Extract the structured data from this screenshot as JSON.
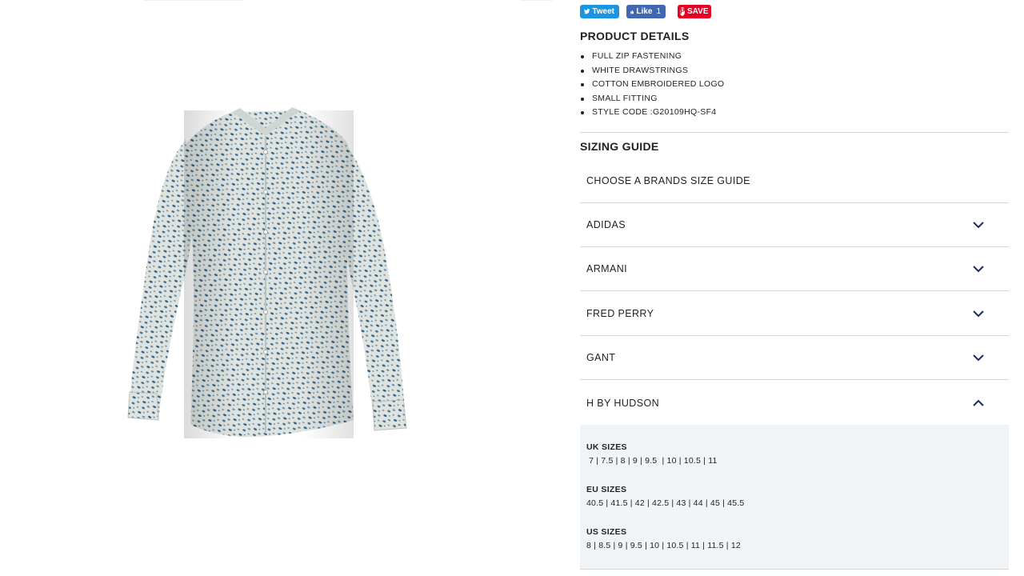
{
  "share": {
    "tweet_label": "Tweet",
    "like_label": "Like",
    "like_count": "1",
    "save_label": "SAVE"
  },
  "product_details": {
    "title": "PRODUCT DETAILS",
    "items": [
      "FULL ZIP FASTENING",
      "WHITE DRAWSTRINGS",
      "COTTON EMBROIDERED LOGO",
      "SMALL FITTING",
      "STYLE CODE :G20109HQ-SF4"
    ]
  },
  "sizing_guide": {
    "title": "SIZING GUIDE",
    "choose_label": "CHOOSE A BRANDS SIZE GUIDE",
    "brands": [
      {
        "label": "ADIDAS",
        "expanded": false
      },
      {
        "label": "ARMANI",
        "expanded": false
      },
      {
        "label": "FRED PERRY",
        "expanded": false
      },
      {
        "label": "GANT",
        "expanded": false
      },
      {
        "label": "H BY HUDSON",
        "expanded": true
      }
    ],
    "expanded_sizes": {
      "uk": {
        "label": "UK SIZES",
        "values": " 7 | 7.5 | 8 | 9 | 9.5  | 10 | 10.5 | 11"
      },
      "eu": {
        "label": "EU SIZES",
        "values": "40.5 | 41.5 | 42 | 42.5 | 43 | 44 | 45 | 45.5"
      },
      "us": {
        "label": "US SIZES",
        "values": "8 | 8.5 | 9 | 9.5 | 10 | 10.5 | 11 | 11.5 | 12"
      }
    }
  },
  "colors": {
    "tweet": "#1b95e0",
    "facebook": "#4267b2",
    "pinterest": "#e60023",
    "chevron": "#1f2a5c",
    "panel_bg": "#f1f4f7"
  },
  "image": {
    "semantic": "patterned long-sleeve shirt product photo"
  }
}
